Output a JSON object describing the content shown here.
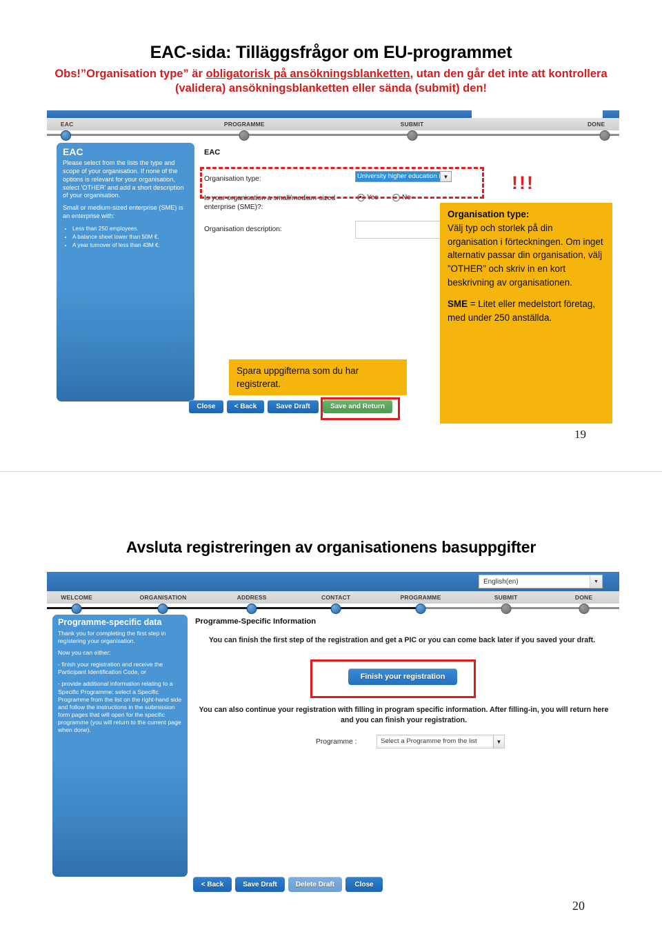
{
  "slide1": {
    "page_number": "19",
    "title": "EAC-sida: Tilläggsfrågor om EU-programmet",
    "subtitle_part1": "Obs!”Organisation type” är ",
    "subtitle_underlined": "obligatorisk på ansökningsblanketten",
    "subtitle_part2": ", utan den går det inte att kontrollera (validera) ansökningsblanketten eller sända (submit) den!",
    "nav_steps": [
      {
        "label": "EAC",
        "state": "active"
      },
      {
        "label": "PROGRAMME",
        "state": "idle"
      },
      {
        "label": "SUBMIT",
        "state": "idle"
      },
      {
        "label": "DONE",
        "state": "idle"
      }
    ],
    "info_panel": {
      "heading": "EAC",
      "paragraph1": "Please select from the lists the type and scope of your organisation. If none of the options is relevant for your organisation, select 'OTHER' and add a short description of your organisation.",
      "paragraph2": "Small or medium-sized enterprise (SME) is an enterprise with:",
      "bullets": [
        "Less than 250 employees.",
        "A balance sheet lower than 50M €.",
        "A year turnover of less than 43M €."
      ]
    },
    "form": {
      "section_heading": "EAC",
      "org_type_label": "Organisation type:",
      "org_type_value": "University higher education instit",
      "sme_label": "Is your organisation a small/medium-sized enterprise (SME)?:",
      "sme_yes": "Yes",
      "sme_no": "No",
      "sme_selected": "Yes",
      "org_desc_label": "Organisation description:",
      "org_desc_value": ""
    },
    "exclamation": "!!!",
    "buttons": [
      {
        "label": "Close",
        "style": "blue"
      },
      {
        "label": "< Back",
        "style": "blue"
      },
      {
        "label": "Save Draft",
        "style": "blue"
      },
      {
        "label": "Save and Return",
        "style": "green"
      }
    ],
    "callout_right": {
      "title": "Organisation type:",
      "body": "Välj typ och storlek på din organisation i förteckningen. Om inget alternativ passar din organisation, välj ”OTHER” och skriv in en kort beskrivning av organisationen.",
      "sme_term": "SME",
      "sme_body": " = Litet eller medelstort företag, med under 250 anställda."
    },
    "callout_save": "Spara uppgifterna som du har registrerat."
  },
  "slide2": {
    "page_number": "20",
    "title": "Avsluta registreringen av organisationens basuppgifter",
    "language": "English(en)",
    "nav_steps": [
      {
        "label": "WELCOME",
        "state": "active"
      },
      {
        "label": "ORGANISATION",
        "state": "active"
      },
      {
        "label": "ADDRESS",
        "state": "active"
      },
      {
        "label": "CONTACT",
        "state": "active"
      },
      {
        "label": "PROGRAMME",
        "state": "active"
      },
      {
        "label": "SUBMIT",
        "state": "idle"
      },
      {
        "label": "DONE",
        "state": "idle"
      }
    ],
    "info_panel": {
      "heading": "Programme-specific data",
      "paragraph1": "Thank you for completing the first step in registering your organisation.",
      "paragraph2": "Now you can either:",
      "paragraph3": "- finish your registration and receive the Participant Identification Code, or",
      "paragraph4": "- provide additional information relating to a Specific Programme: select a Specific Programme from the list on the right-hand side and follow the instructions in the submission form pages that will open for the specific programme (you will return to the current page when done)."
    },
    "section_heading": "Programme-Specific Information",
    "paragraph_top": "You can finish the first step of the registration and get a PIC or you can come back later if you saved your draft.",
    "finish_button": "Finish your registration",
    "paragraph_bottom": "You can also continue your registration with filling in program specific information. After filling-in, you will return here and you can finish your registration.",
    "programme_label": "Programme :",
    "programme_value": "Select a Programme from the list",
    "buttons": [
      {
        "label": "< Back",
        "style": "blue"
      },
      {
        "label": "Save Draft",
        "style": "blue"
      },
      {
        "label": "Delete Draft",
        "style": "muted"
      },
      {
        "label": "Close",
        "style": "blue"
      }
    ]
  },
  "colors": {
    "accent_blue": "#2f70ad",
    "callout_orange": "#f5b50d",
    "alert_red": "#d71a1a",
    "green_button": "#4f9c4f"
  }
}
